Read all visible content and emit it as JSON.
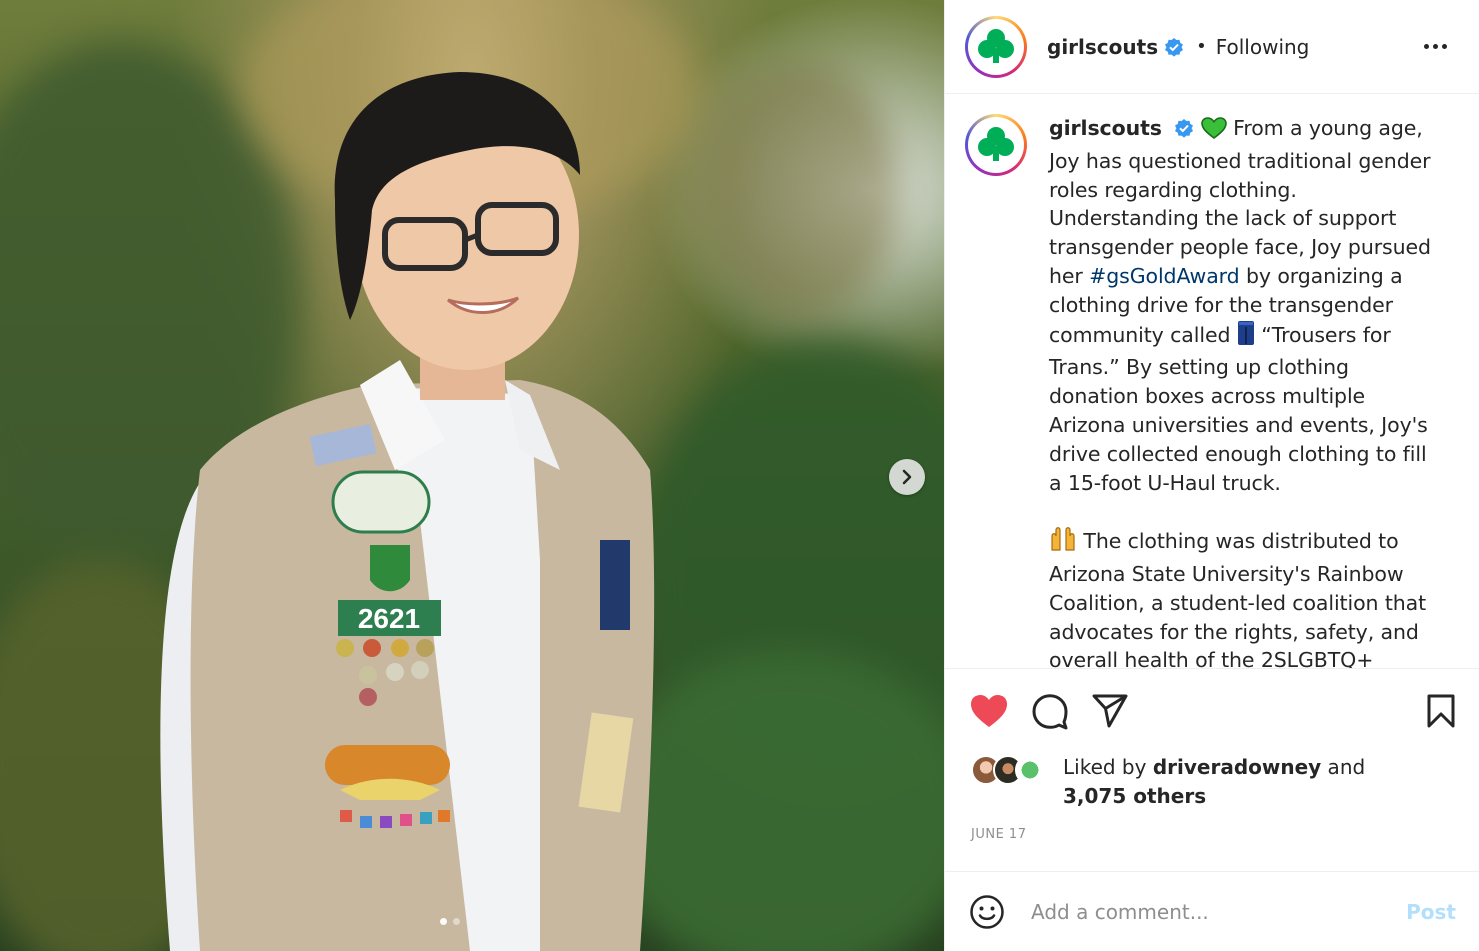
{
  "post": {
    "username": "girlscouts",
    "follow_status": "Following",
    "separator": "•"
  },
  "caption": {
    "username": "girlscouts",
    "part1": "From a young age, Joy has questioned traditional gender roles regarding clothing. Understanding the lack of support transgender people face, Joy pursued her ",
    "hashtag": "#gsGoldAward",
    "part2": " by organizing a clothing drive for the transgender community called ",
    "part3": " “Trousers for Trans.” By setting up clothing donation boxes across multiple Arizona universities and events, Joy's drive collected enough clothing to fill a 15-foot U-Haul truck.",
    "para2": "The clothing was distributed to Arizona State University's Rainbow Coalition, a student-led coalition that advocates for the rights, safety, and overall health of the 2SLGBTQ+"
  },
  "likes": {
    "prefix": "Liked by ",
    "user": "driveradowney",
    "suffix": " and",
    "others": "3,075 others"
  },
  "date": "JUNE 17",
  "comment": {
    "placeholder": "Add a comment...",
    "post_label": "Post"
  },
  "icons": {
    "like": "heart-filled-icon",
    "comment": "comment-icon",
    "share": "share-icon",
    "save": "bookmark-icon",
    "emoji": "emoji-icon",
    "next": "chevron-right-icon",
    "more": "more-icon"
  },
  "colors": {
    "like_red": "#ed4956",
    "verified_blue": "#3897f0",
    "brand_green": "#00ae58",
    "hashtag": "#00376b",
    "post_disabled": "#b2dffc"
  },
  "photo": {
    "badge_number": "2621",
    "slide_index": 1,
    "slide_count": 2
  }
}
